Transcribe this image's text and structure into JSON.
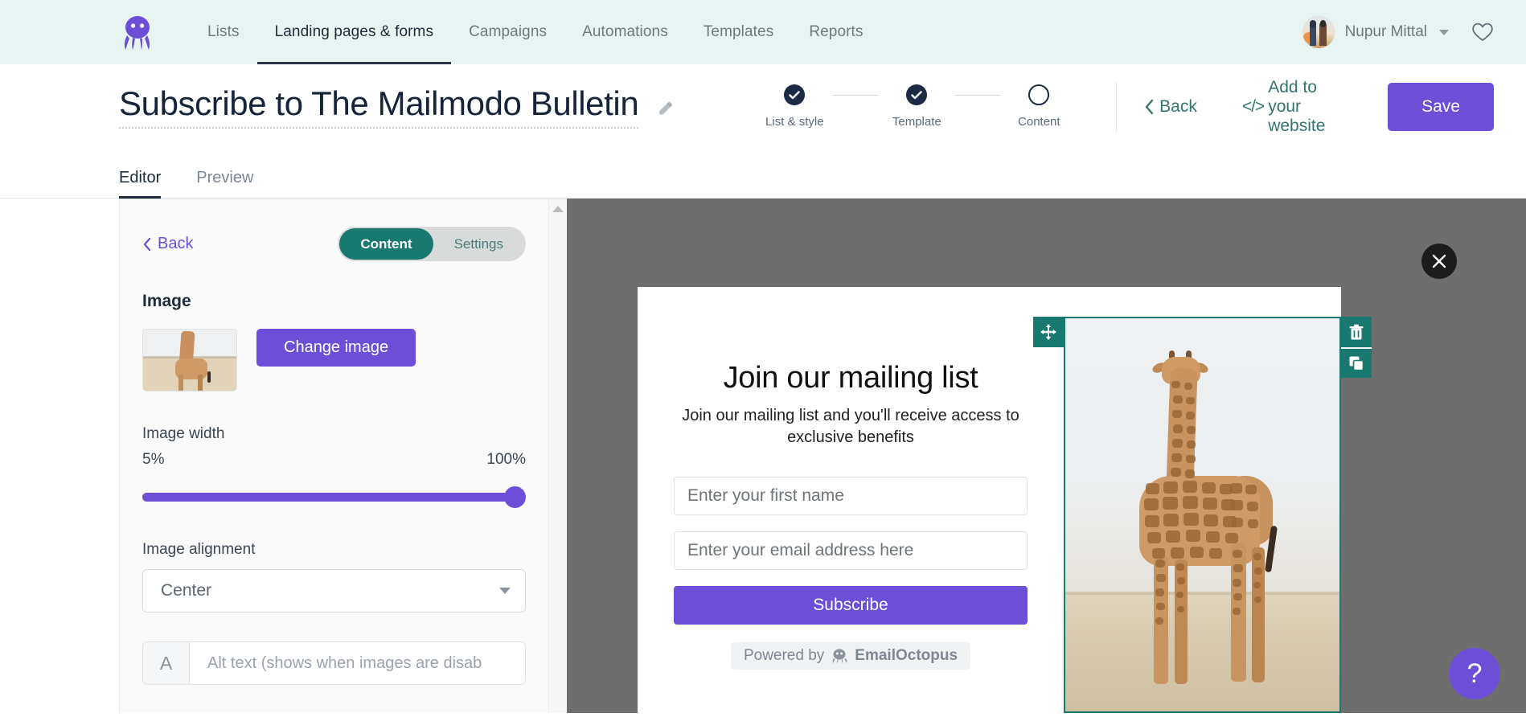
{
  "topnav": {
    "logo_name": "emailoctopus-logo",
    "links": [
      {
        "label": "Lists",
        "active": false
      },
      {
        "label": "Landing pages & forms",
        "active": true
      },
      {
        "label": "Campaigns",
        "active": false
      },
      {
        "label": "Automations",
        "active": false
      },
      {
        "label": "Templates",
        "active": false
      },
      {
        "label": "Reports",
        "active": false
      }
    ],
    "user_name": "Nupur Mittal",
    "favorites_icon": "heart-icon"
  },
  "header": {
    "title": "Subscribe to The Mailmodo Bulletin",
    "edit_icon": "pencil-icon",
    "steps": [
      {
        "label": "List & style",
        "state": "complete"
      },
      {
        "label": "Template",
        "state": "complete"
      },
      {
        "label": "Content",
        "state": "current"
      }
    ],
    "back_label": "Back",
    "embed_label": "Add to your website",
    "embed_icon": "code-icon",
    "save_label": "Save"
  },
  "tabs": [
    {
      "label": "Editor",
      "active": true
    },
    {
      "label": "Preview",
      "active": false
    }
  ],
  "panel": {
    "back_label": "Back",
    "segments": [
      {
        "label": "Content",
        "active": true
      },
      {
        "label": "Settings",
        "active": false
      }
    ],
    "section_title": "Image",
    "thumbnail_name": "giraffe-image-thumbnail",
    "change_image_label": "Change image",
    "width_label": "Image width",
    "width_min": "5%",
    "width_max": "100%",
    "width_value": 100,
    "alignment_label": "Image alignment",
    "alignment_value": "Center",
    "alt_icon_glyph": "A",
    "alt_placeholder": "Alt text (shows when images are disab"
  },
  "canvas": {
    "close_icon": "close-icon",
    "form": {
      "title": "Join our mailing list",
      "subtitle": "Join our mailing list and you'll receive access to exclusive benefits",
      "first_name_placeholder": "Enter your first name",
      "email_placeholder": "Enter your email address here",
      "subscribe_label": "Subscribe",
      "powered_by_text": "Powered by",
      "powered_by_brand": "EmailOctopus"
    },
    "selected_block": {
      "name": "image-block",
      "move_icon": "move-icon",
      "delete_icon": "trash-icon",
      "duplicate_icon": "duplicate-icon"
    }
  },
  "help": {
    "label": "?"
  },
  "colors": {
    "nav_bg": "#e8f4f1",
    "primary_purple": "#6c4fd6",
    "teal": "#19796f",
    "link_teal": "#33756d",
    "dark_navy": "#1b2a44",
    "canvas_gray": "#6e6e6e"
  }
}
